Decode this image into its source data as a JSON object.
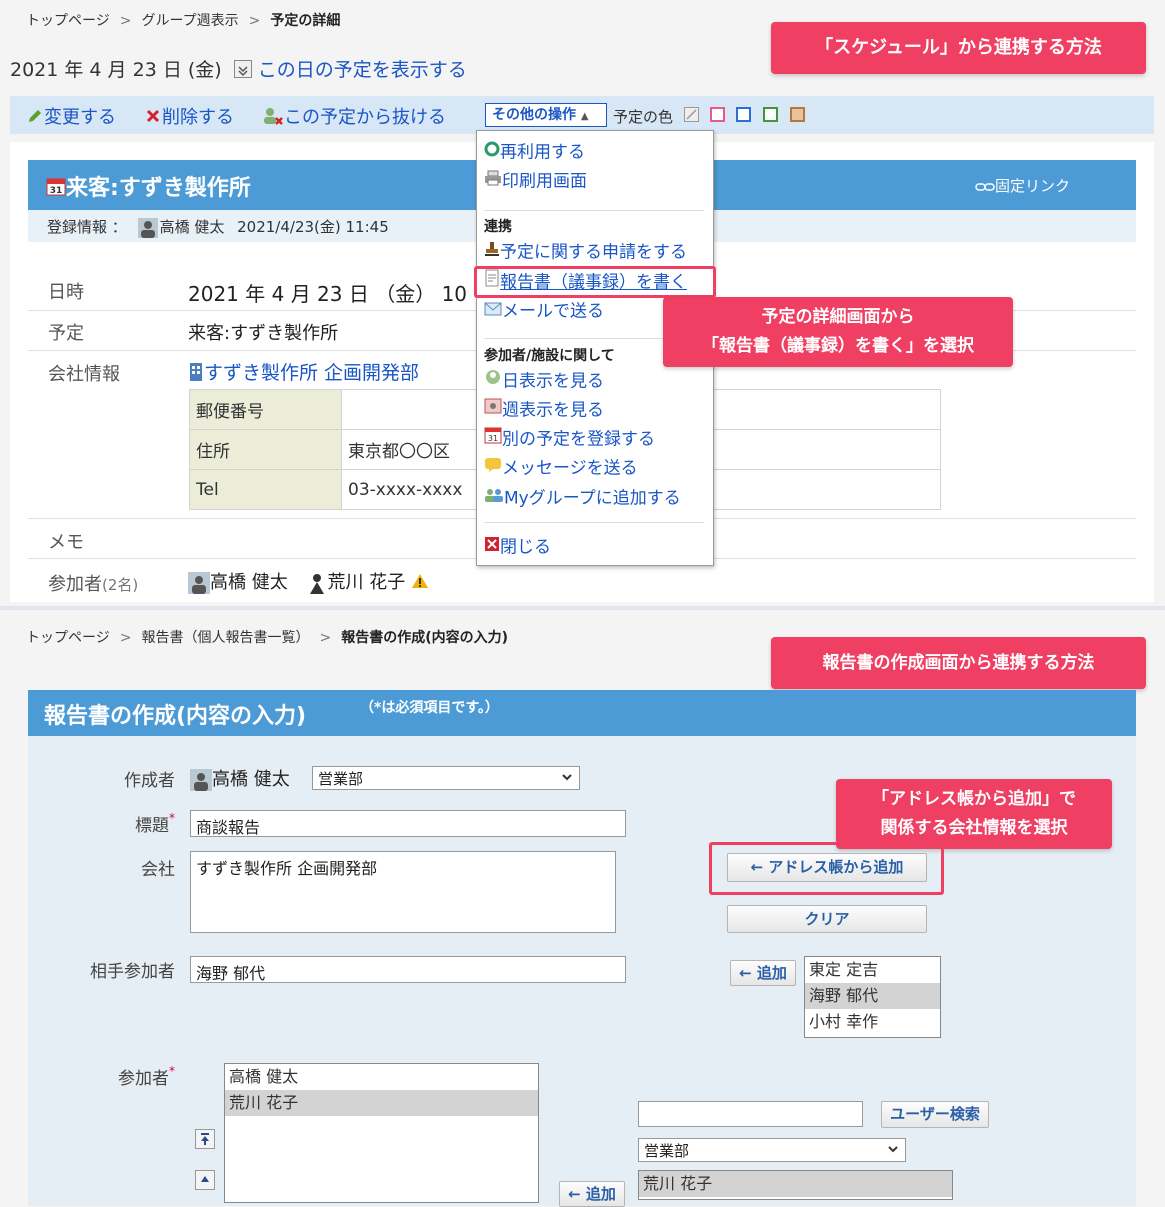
{
  "top": {
    "breadcrumb": {
      "item1": "トップページ",
      "item2": "グループ週表示",
      "current": "予定の詳細"
    },
    "date": "2021 年 4 月 23 日 (金)",
    "show_day_link": "この日の予定を表示する",
    "callout_schedule": "「スケジュール」から連携する方法",
    "toolbar": {
      "edit": "変更する",
      "delete": "削除する",
      "leave": "この予定から抜ける",
      "other_ops": "その他の操作",
      "color_label": "予定の色"
    },
    "colors": {
      "pink": "#e85a8a",
      "blue": "#2a6fd6",
      "green": "#3a9a3a",
      "brown": "#b07a3a",
      "accent": "#ef3f62",
      "header_blue": "#4c9bd6"
    },
    "detail": {
      "title": "来客:すずき製作所",
      "permalink": "固定リンク",
      "reg_label": "登録情報 ：",
      "reg_user": "高橋 健太",
      "reg_date": "2021/4/23(金) 11:45",
      "datetime_label": "日時",
      "datetime_value": "2021 年 4 月 23 日 （金） 10",
      "plan_label": "予定",
      "plan_value": "来客:すずき製作所",
      "company_label": "会社情報",
      "company_link": "すずき製作所 企画開発部",
      "company_rows": [
        {
          "k": "郵便番号",
          "v": ""
        },
        {
          "k": "住所",
          "v": "東京都〇〇区"
        },
        {
          "k": "Tel",
          "v": "03-xxxx-xxxx"
        }
      ],
      "memo_label": "メモ",
      "participants_label": "参加者",
      "participants_count": "(2名)",
      "participant1": "高橋 健太",
      "participant2": "荒川 花子"
    },
    "menu": {
      "reuse": "再利用する",
      "print": "印刷用画面",
      "section_link": "連携",
      "apply": "予定に関する申請をする",
      "report": "報告書（議事録）を書く",
      "mail": "メールで送る",
      "section_participants": "参加者/施設に関して",
      "day_view": "日表示を見る",
      "week_view": "週表示を見る",
      "register_other": "別の予定を登録する",
      "send_message": "メッセージを送る",
      "add_mygroup": "Myグループに追加する",
      "close": "閉じる"
    },
    "callout_report_line1": "予定の詳細画面から",
    "callout_report_line2": "「報告書（議事録）を書く」を選択"
  },
  "bottom": {
    "breadcrumb": {
      "item1": "トップページ",
      "item2": "報告書（個人報告書一覧）",
      "current": "報告書の作成(内容の入力)"
    },
    "callout_method": "報告書の作成画面から連携する方法",
    "header_title": "報告書の作成(内容の入力)",
    "required_note": "（*は必須項目です。）",
    "callout_address_line1": "「アドレス帳から追加」で",
    "callout_address_line2": "関係する会社情報を選択",
    "form": {
      "author_label": "作成者",
      "author_name": "高橋 健太",
      "dept_selected": "営業部",
      "title_label": "標題",
      "title_value": "商談報告",
      "company_label": "会社",
      "company_value": "すずき製作所 企画開発部",
      "add_from_address": "← アドレス帳から追加",
      "clear": "クリア",
      "partner_label": "相手参加者",
      "partner_value": "海野 郁代",
      "add": "← 追加",
      "partner_list": [
        "東定 定吉",
        "海野 郁代",
        "小村 幸作"
      ],
      "participants_label": "参加者",
      "participants_list": [
        "高橋 健太",
        "荒川 花子"
      ],
      "user_search": "ユーザー検索",
      "dept2_selected": "営業部",
      "candidates": [
        "荒川 花子"
      ]
    }
  }
}
